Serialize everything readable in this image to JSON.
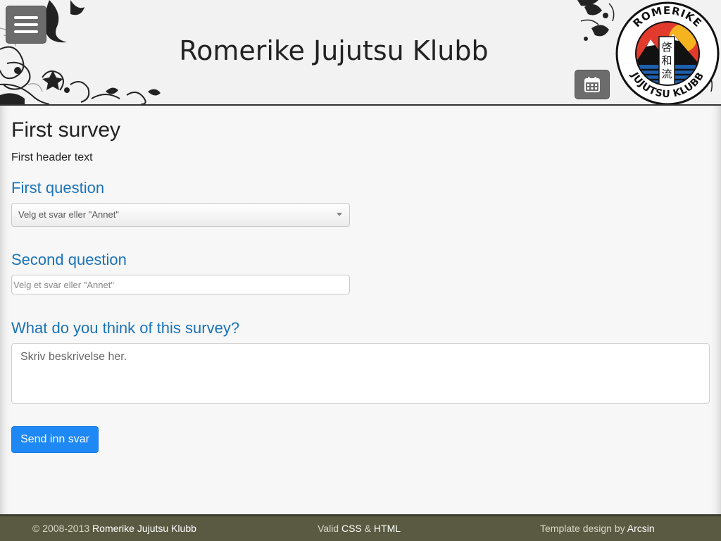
{
  "header": {
    "site_title": "Romerike Jujutsu Klubb",
    "logo_text_top": "ROMERIKE",
    "logo_text_bottom": "JUJUTSU KLUBB",
    "logo_kanji": [
      "啓",
      "和",
      "流"
    ]
  },
  "survey": {
    "title": "First survey",
    "header_text": "First header text",
    "questions": [
      {
        "label": "First question",
        "select_value": "Velg et svar eller \"Annet\""
      },
      {
        "label": "Second question",
        "placeholder": "Velg et svar eller \"Annet\""
      },
      {
        "label": "What do you think of this survey?",
        "placeholder": "Skriv beskrivelse her."
      }
    ],
    "submit_label": "Send inn svar"
  },
  "footer": {
    "copyright_prefix": "© 2008-2013",
    "copyright_name": "Romerike Jujutsu Klubb",
    "valid_prefix": "Valid",
    "valid_css": "CSS",
    "valid_amp": "&",
    "valid_html": "HTML",
    "template_prefix": "Template design by",
    "template_author": "Arcsin"
  },
  "colors": {
    "accent": "#1a73b8",
    "button": "#1e88f5",
    "footer_bg": "#5a5a42"
  }
}
